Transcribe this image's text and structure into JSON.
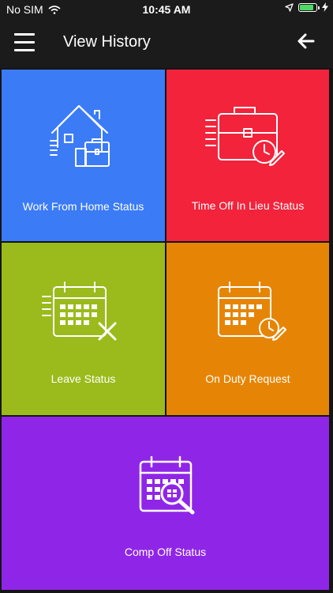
{
  "status_bar": {
    "carrier": "No SIM",
    "time": "10:45 AM",
    "battery_level": 0.85,
    "icons": [
      "wifi-icon",
      "location-arrow-icon",
      "battery-icon",
      "charging-bolt-icon"
    ]
  },
  "header": {
    "title": "View History",
    "icons": [
      "hamburger-menu-icon",
      "back-arrow-icon"
    ]
  },
  "tiles": [
    {
      "label": "Work From Home Status",
      "icon": "house-briefcase-icon",
      "color": "#3b7bf6"
    },
    {
      "label": "Time Off In Lieu Status",
      "icon": "briefcase-clock-icon",
      "color": "#f2233b"
    },
    {
      "label": "Leave Status",
      "icon": "calendar-cross-icon",
      "color": "#9abb1b"
    },
    {
      "label": "On Duty Request",
      "icon": "calendar-clock-icon",
      "color": "#e68505"
    },
    {
      "label": "Comp Off Status",
      "icon": "calendar-search-icon",
      "color": "#8f26e7"
    }
  ],
  "colors": {
    "bar_background": "#1b1b1b",
    "grid_gap": "#151515"
  }
}
